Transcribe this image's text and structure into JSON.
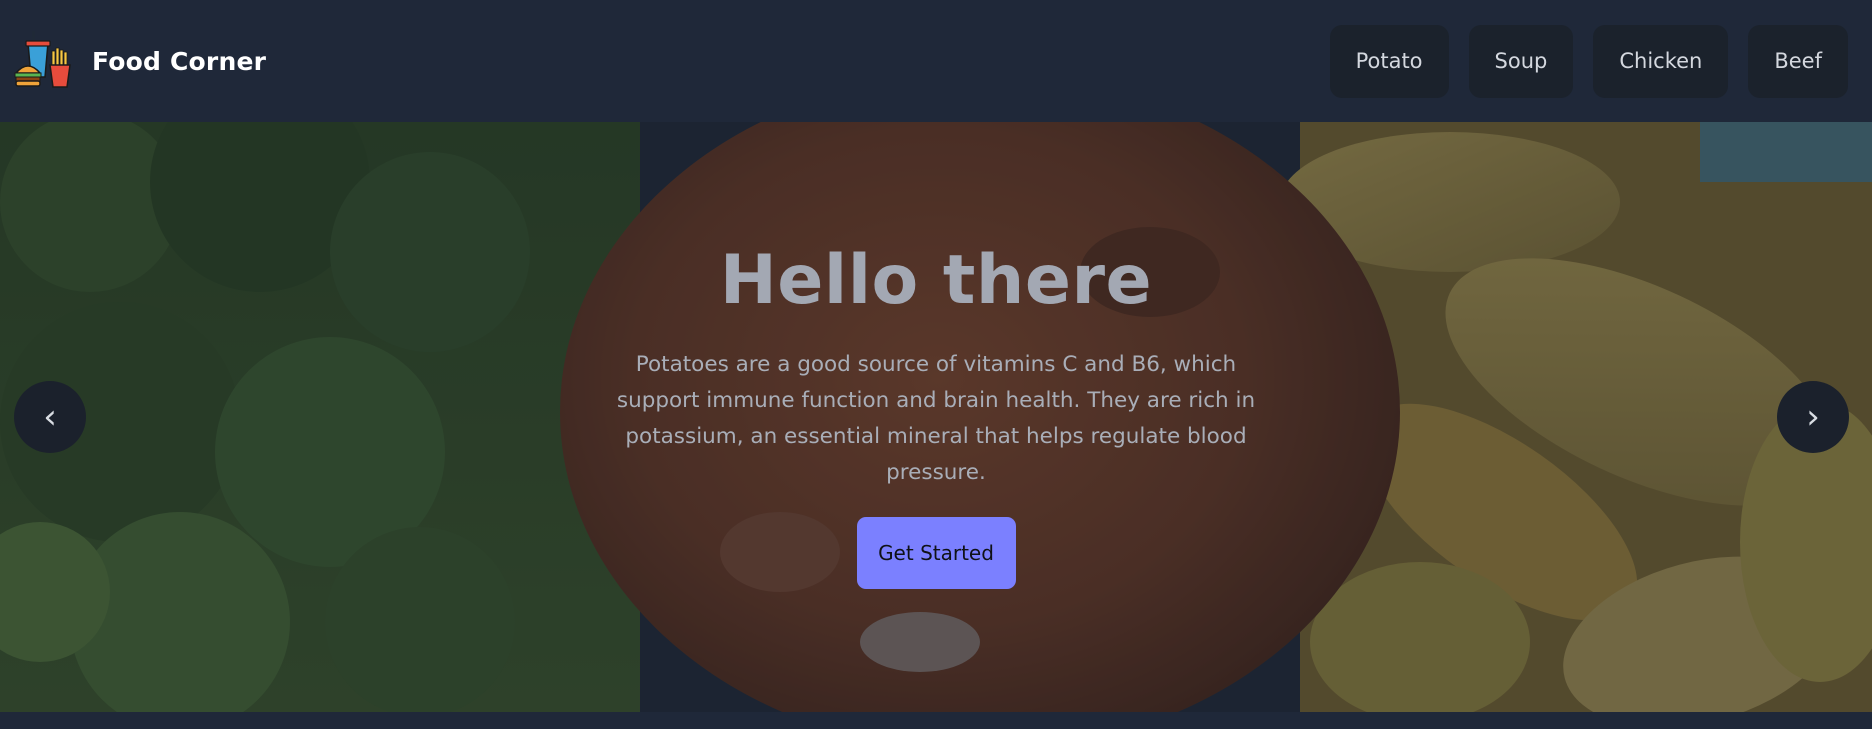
{
  "brand": {
    "name": "Food Corner",
    "logo_icon": "fast-food-icon"
  },
  "nav": {
    "items": [
      "Potato",
      "Soup",
      "Chicken",
      "Beef"
    ]
  },
  "hero": {
    "title": "Hello there",
    "text": "Potatoes are a good source of vitamins C and B6, which support immune function and brain health. They are rich in potassium, an essential mineral that helps regulate blood pressure.",
    "cta": "Get Started",
    "prev_icon": "‹",
    "next_icon": "›"
  },
  "colors": {
    "navbar": "#1f2839",
    "nav_button": "#1b222c",
    "accent": "#7b80ff",
    "overlay": "rgba(24,30,42,0.42)"
  }
}
